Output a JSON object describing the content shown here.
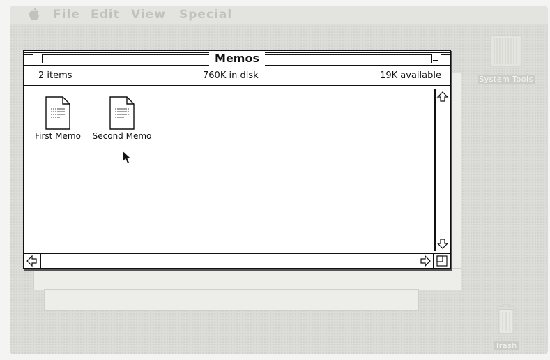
{
  "menubar": {
    "apple_icon": "apple-icon",
    "items": [
      "File",
      "Edit",
      "View",
      "Special"
    ]
  },
  "window": {
    "title": "Memos",
    "info": {
      "items": "2 items",
      "in_disk": "760K in disk",
      "available": "19K available"
    },
    "files": [
      {
        "label": "First Memo",
        "icon": "document-icon"
      },
      {
        "label": "Second Memo",
        "icon": "document-icon"
      }
    ]
  },
  "desktop": {
    "system_tools": "System Tools",
    "trash": "Trash"
  },
  "colors": {
    "desktop": "#dcdcd8",
    "window_border": "#111111",
    "disabled_text": "#c2c2bd"
  }
}
